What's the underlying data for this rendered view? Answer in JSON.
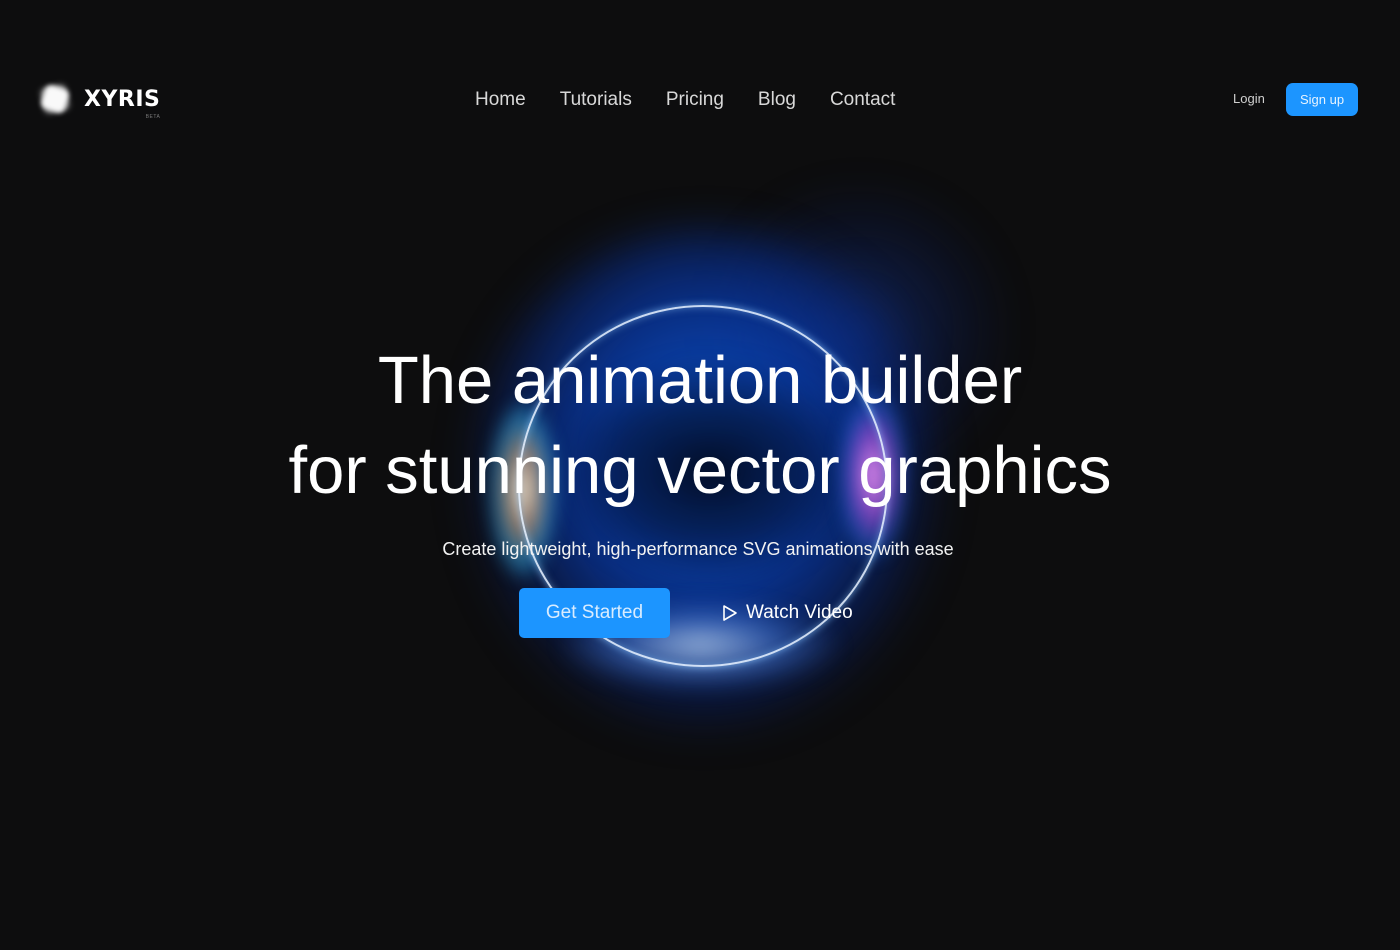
{
  "brand": {
    "name": "XYRIS",
    "badge": "BETA",
    "logo_icon": "blurred-square-glow-icon"
  },
  "nav": {
    "items": [
      {
        "label": "Home"
      },
      {
        "label": "Tutorials"
      },
      {
        "label": "Pricing"
      },
      {
        "label": "Blog"
      },
      {
        "label": "Contact"
      }
    ]
  },
  "auth": {
    "login_label": "Login",
    "signup_label": "Sign up"
  },
  "hero": {
    "title_line1": "The animation builder",
    "title_line2": "for stunning vector graphics",
    "subtitle": "Create lightweight, high-performance SVG animations with ease",
    "primary_cta": "Get Started",
    "secondary_cta": "Watch Video",
    "secondary_icon": "play-outline-icon"
  },
  "colors": {
    "background": "#0d0d0e",
    "accent": "#1c95ff",
    "text": "#ffffff",
    "nav_text": "#d8d8d8"
  }
}
